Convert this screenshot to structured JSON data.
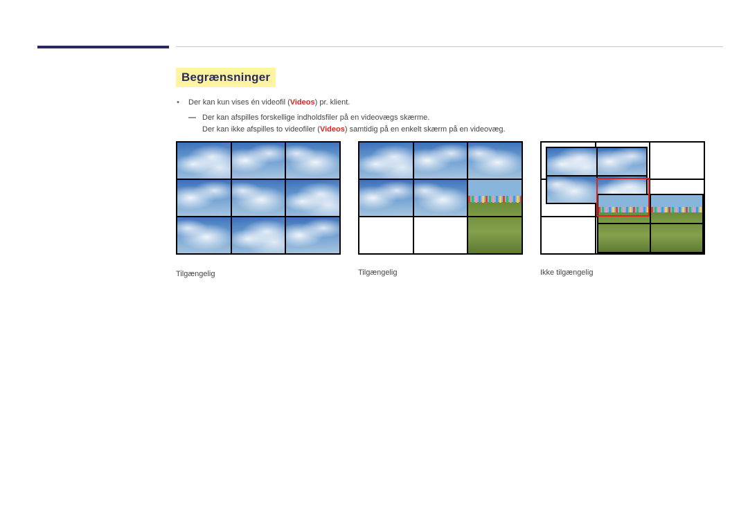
{
  "heading": "Begrænsninger",
  "bullet": {
    "text_before": "Der kan kun vises én videofil (",
    "videos_word": "Videos",
    "text_after": ") pr. klient."
  },
  "sub": {
    "line1": "Der kan afspilles forskellige indholdsfiler på en videovægs skærme.",
    "line2_before": "Der kan ikke afspilles to videofiler (",
    "line2_videos": "Videos",
    "line2_after": ") samtidig på en enkelt skærm på en videovæg."
  },
  "captions": {
    "g1": "Tilgængelig",
    "g2": "Tilgængelig",
    "g3": "Ikke tilgængelig"
  }
}
